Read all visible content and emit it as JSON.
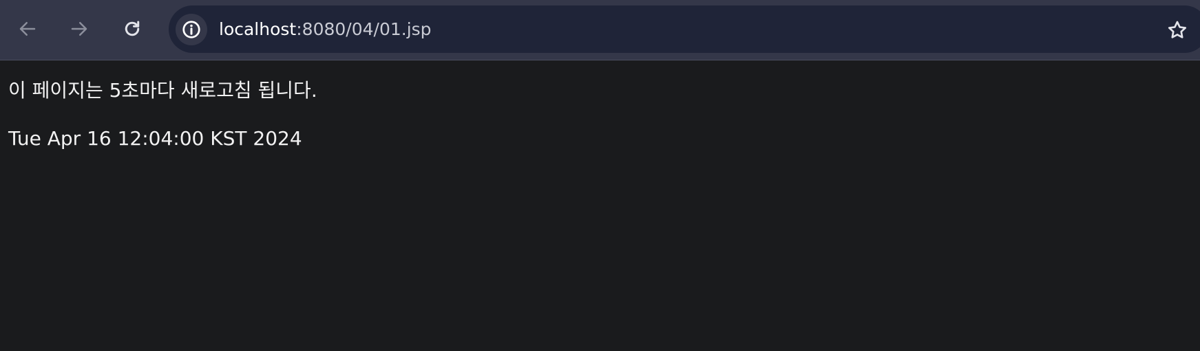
{
  "browser": {
    "url_host": "localhost",
    "url_rest": ":8080/04/01.jsp",
    "icons": {
      "back": "arrow-left-icon",
      "forward": "arrow-right-icon",
      "reload": "reload-icon",
      "site_info": "info-icon",
      "bookmark": "star-icon"
    },
    "colors": {
      "toolbar": "#343749",
      "omnibox": "#1f2438",
      "page_background": "#1a1b1d"
    }
  },
  "page": {
    "notice": "이 페이지는 5초마다 새로고침 됩니다.",
    "date": "Tue Apr 16 12:04:00 KST 2024"
  }
}
